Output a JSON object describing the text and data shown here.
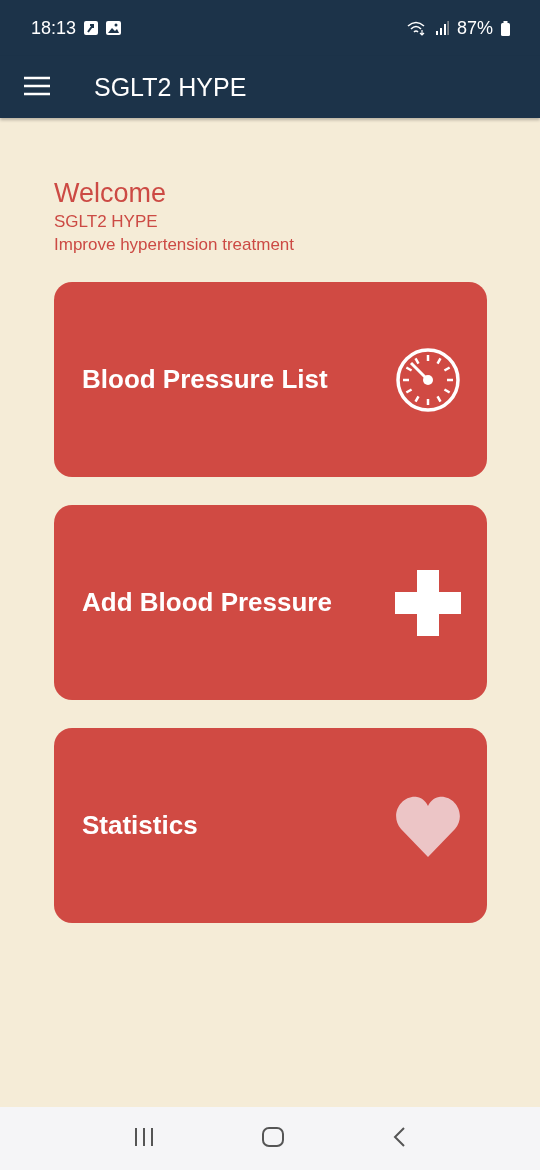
{
  "status_bar": {
    "time": "18:13",
    "battery": "87%"
  },
  "app_bar": {
    "title": "SGLT2 HYPE"
  },
  "welcome": {
    "heading": "Welcome",
    "app_name": "SGLT2 HYPE",
    "tagline": "Improve hypertension treatment"
  },
  "cards": [
    {
      "label": "Blood Pressure List",
      "kind": "gauge"
    },
    {
      "label": "Add Blood Pressure",
      "kind": "plus"
    },
    {
      "label": "Statistics",
      "kind": "heart"
    }
  ]
}
